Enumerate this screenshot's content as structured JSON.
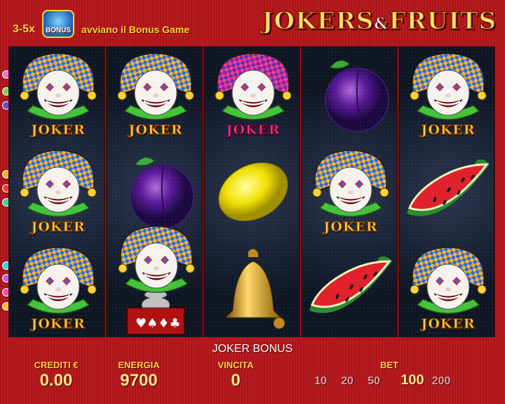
{
  "header": {
    "hint_range": "3-5x",
    "hint_badge": "BONUS",
    "hint_message": "avviano il Bonus Game",
    "logo_jokers": "JOKERS",
    "logo_amp": "&",
    "logo_fruits": "FRUITS"
  },
  "reels": {
    "joker_label": "JOKER",
    "grid": [
      [
        "joker",
        "joker",
        "joker"
      ],
      [
        "joker",
        "plum",
        "jack-in-the-box"
      ],
      [
        "joker-purple",
        "lemon",
        "bell"
      ],
      [
        "plum",
        "joker",
        "watermelon"
      ],
      [
        "joker",
        "watermelon",
        "joker"
      ]
    ]
  },
  "bottom": {
    "bonus_title": "JOKER BONUS",
    "credits_label": "CREDITI €",
    "credits_value": "0.00",
    "energy_label": "ENERGIA",
    "energy_value": "9700",
    "win_label": "VINCITA",
    "win_value": "0",
    "bet_label": "BET",
    "bet_options": [
      "10",
      "20",
      "50",
      "100",
      "200"
    ],
    "bet_selected": "100"
  },
  "colors": {
    "frame_red": "#b81c20",
    "accent_gold": "#ffd23a",
    "reel_dark": "#121a2a"
  }
}
